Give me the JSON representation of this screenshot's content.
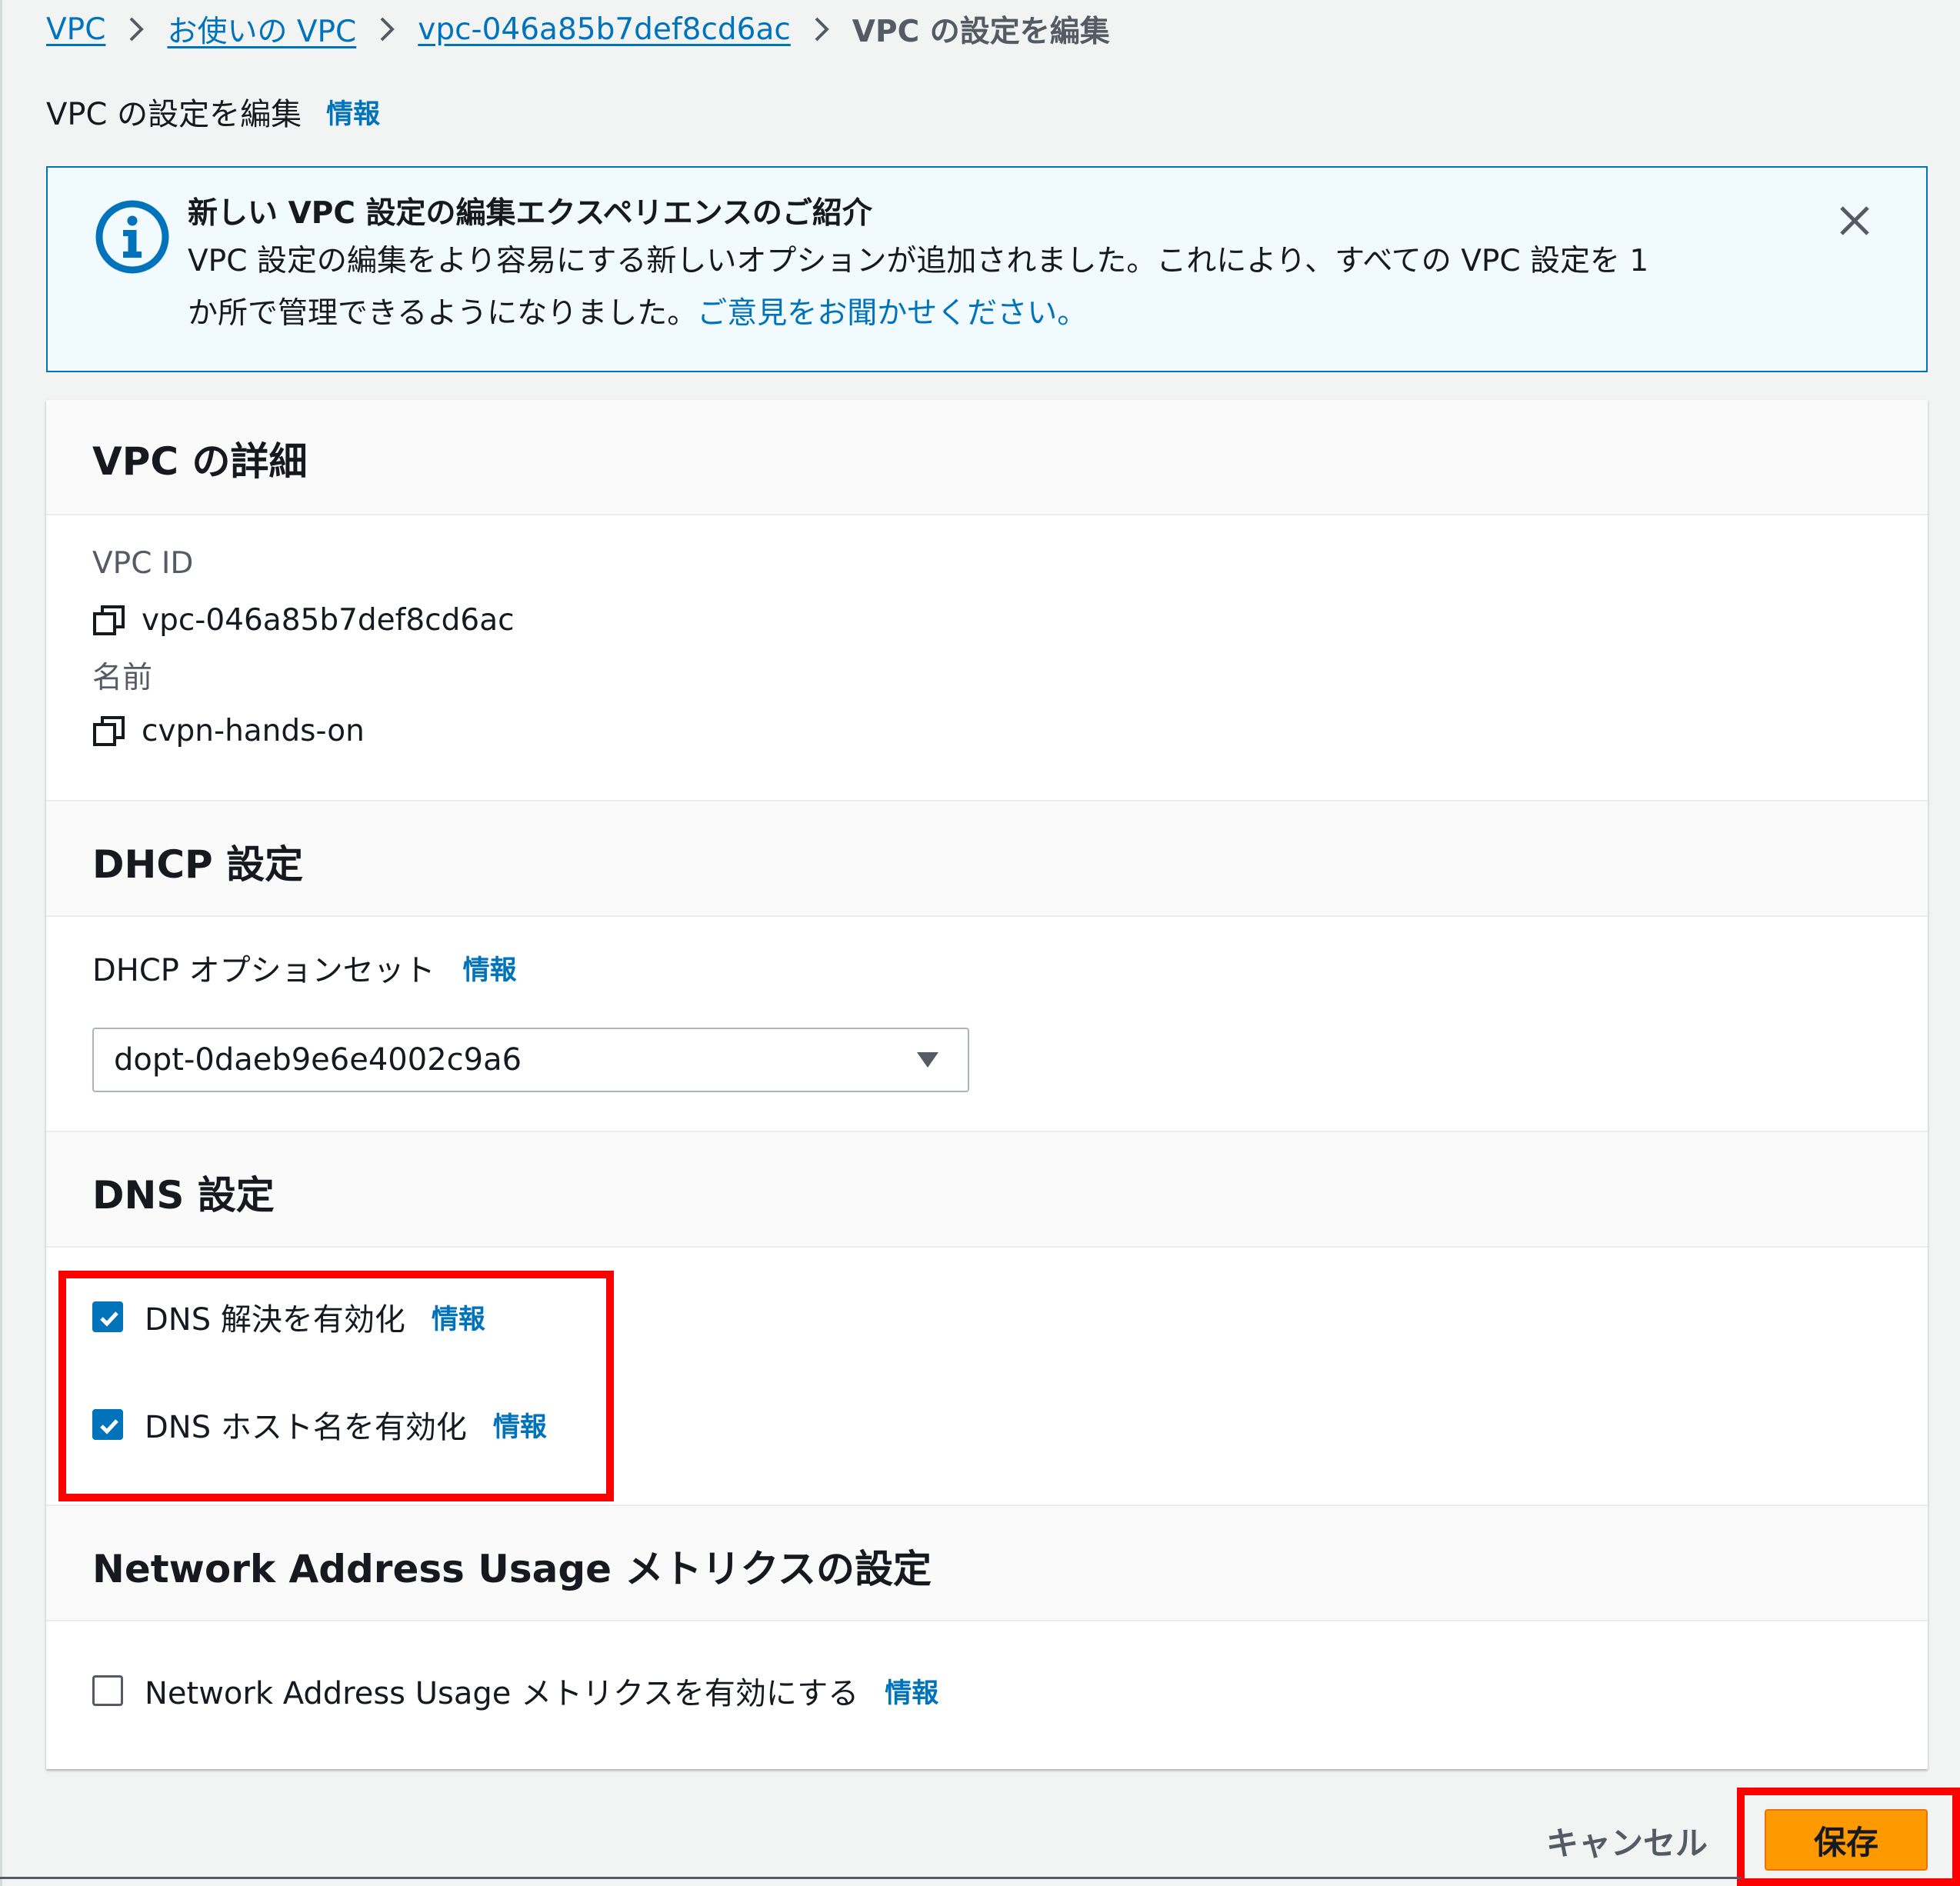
{
  "breadcrumb": {
    "items": [
      {
        "label": "VPC"
      },
      {
        "label": "お使いの VPC"
      },
      {
        "label": "vpc-046a85b7def8cd6ac"
      }
    ],
    "current": "VPC の設定を編集"
  },
  "page": {
    "title": "VPC の設定を編集",
    "info": "情報"
  },
  "flash": {
    "title": "新しい VPC 設定の編集エクスペリエンスのご紹介",
    "body_line1": "VPC 設定の編集をより容易にする新しいオプションが追加されました。これにより、すべての VPC 設定を 1",
    "body_line2": "か所で管理できるようになりました。",
    "link": "ご意見をお聞かせください。",
    "icon": "info-circle-icon"
  },
  "details": {
    "header": "VPC の詳細",
    "vpc_id_label": "VPC ID",
    "vpc_id_value": "vpc-046a85b7def8cd6ac",
    "name_label": "名前",
    "name_value": "cvpn-hands-on"
  },
  "dhcp": {
    "header": "DHCP 設定",
    "option_set_label": "DHCP オプションセット",
    "info": "情報",
    "selected_value": "dopt-0daeb9e6e4002c9a6"
  },
  "dns": {
    "header": "DNS 設定",
    "resolution_label": "DNS 解決を有効化",
    "resolution_checked": true,
    "hostnames_label": "DNS ホスト名を有効化",
    "hostnames_checked": true,
    "info": "情報"
  },
  "nau": {
    "header": "Network Address Usage メトリクスの設定",
    "enable_label": "Network Address Usage メトリクスを有効にする",
    "enable_checked": false,
    "info": "情報"
  },
  "footer": {
    "cancel_label": "キャンセル",
    "save_label": "保存"
  },
  "colors": {
    "link": "#0073bb",
    "primary_button": "#ff9900",
    "highlight": "#ff0000",
    "info_banner_bg": "#f1faff"
  }
}
